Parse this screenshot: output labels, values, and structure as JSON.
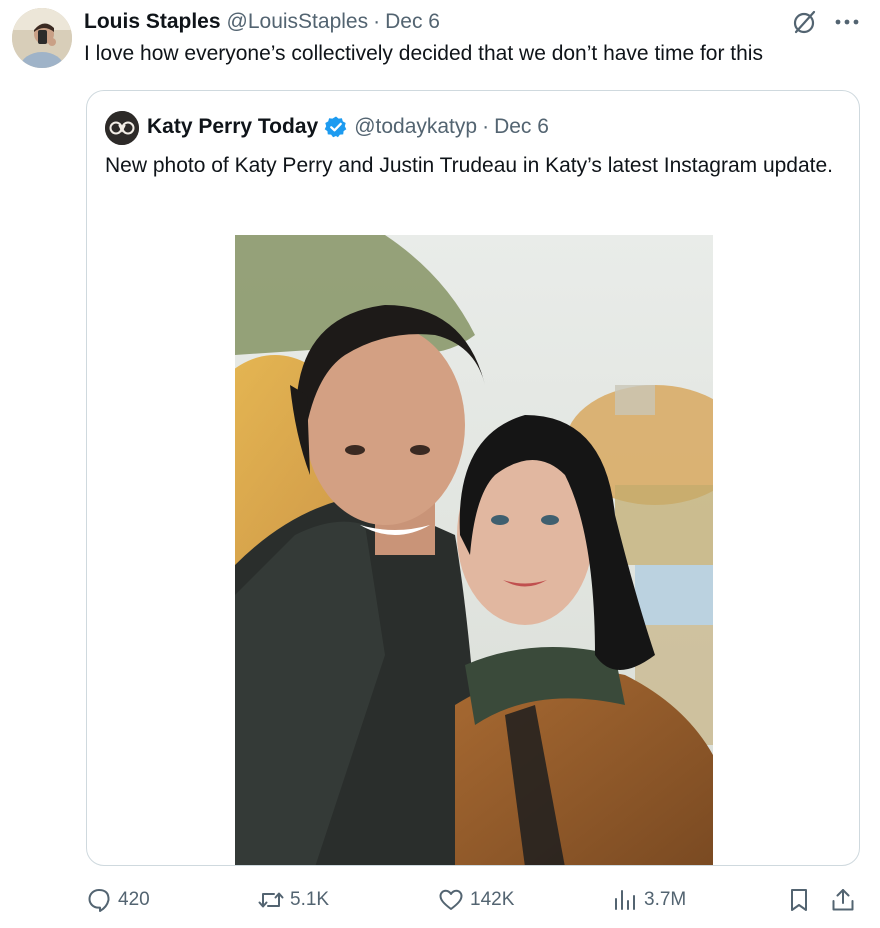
{
  "tweet": {
    "author": {
      "name": "Louis Staples",
      "handle": "@LouisStaples",
      "separator": "·",
      "date": "Dec 6"
    },
    "text": "I love how everyone’s collectively decided that we don’t have time for this"
  },
  "quoted_tweet": {
    "author": {
      "name": "Katy Perry Today",
      "handle": "@todaykatyp",
      "separator": "·",
      "date": "Dec 6",
      "verified": true
    },
    "text": "New photo of Katy Perry and Justin Trudeau in Katy’s latest Instagram update."
  },
  "actions": {
    "reply_count": "420",
    "retweet_count": "5.1K",
    "like_count": "142K",
    "views_count": "3.7M"
  },
  "icons": [
    "grok-icon",
    "more-icon",
    "verified-badge-icon",
    "reply-icon",
    "retweet-icon",
    "like-icon",
    "views-icon",
    "bookmark-icon",
    "share-icon"
  ],
  "colors": {
    "text_primary": "#0f1419",
    "text_secondary": "#536471",
    "verified_blue": "#1d9bf0",
    "card_border": "#cfd9de"
  }
}
